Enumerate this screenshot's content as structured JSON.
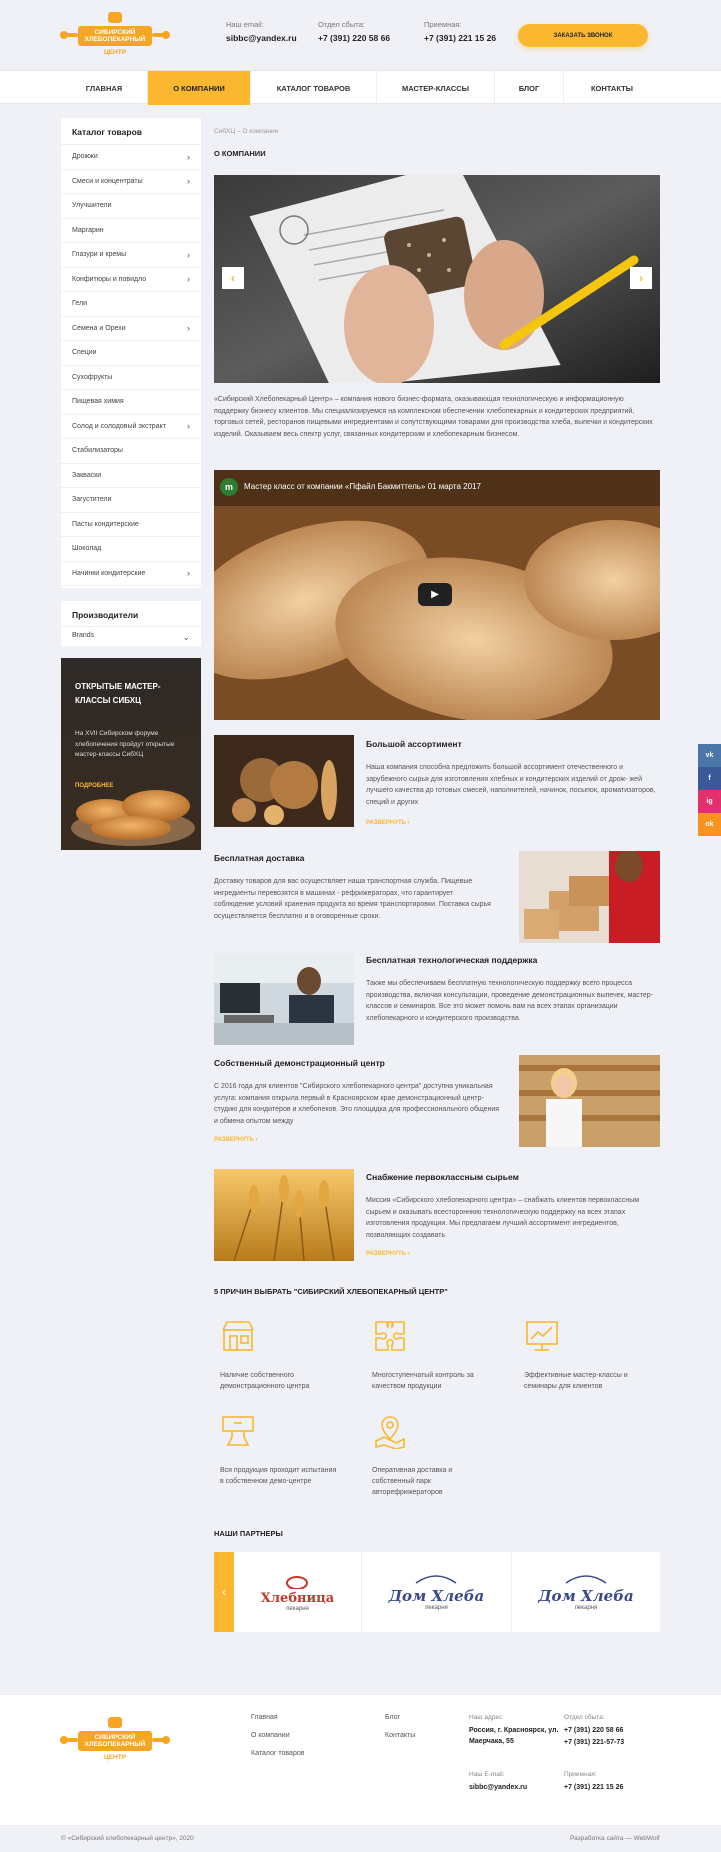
{
  "header": {
    "logo_text": "СИБИРСКИЙ ХЛЕБОПЕКАРНЫЙ ЦЕНТР",
    "email_label": "Наш email:",
    "email": "sibbc@yandex.ru",
    "sales_label": "Отдел сбыта:",
    "sales_phone": "+7 (391) 220 58 66",
    "reception_label": "Приемная:",
    "reception_phone": "+7 (391) 221 15 26",
    "call_button": "ЗАКАЗАТЬ ЗВОНОК"
  },
  "nav": [
    "ГЛАВНАЯ",
    "О КОМПАНИИ",
    "КАТАЛОГ ТОВАРОВ",
    "МАСТЕР-КЛАССЫ",
    "БЛОГ",
    "КОНТАКТЫ"
  ],
  "sidebar": {
    "catalog_title": "Каталог товаров",
    "items": [
      {
        "label": "Дрожжи",
        "arrow": true
      },
      {
        "label": "Смеси и концентраты",
        "arrow": true
      },
      {
        "label": "Улучшители",
        "arrow": false
      },
      {
        "label": "Маргарин",
        "arrow": false
      },
      {
        "label": "Глазури и кремы",
        "arrow": true
      },
      {
        "label": "Конфитюры и повидло",
        "arrow": true
      },
      {
        "label": "Гели",
        "arrow": false
      },
      {
        "label": "Семена и Орехи",
        "arrow": true
      },
      {
        "label": "Специи",
        "arrow": false
      },
      {
        "label": "Сухофрукты",
        "arrow": false
      },
      {
        "label": "Пищевая химия",
        "arrow": false
      },
      {
        "label": "Солод и солодовый экстракт",
        "arrow": true
      },
      {
        "label": "Стабилизаторы",
        "arrow": false
      },
      {
        "label": "Закваски",
        "arrow": false
      },
      {
        "label": "Загустители",
        "arrow": false
      },
      {
        "label": "Пасты кондитерские",
        "arrow": false
      },
      {
        "label": "Шоколад",
        "arrow": false
      },
      {
        "label": "Начинки кондитерские",
        "arrow": true
      }
    ],
    "producers_title": "Производители",
    "producers_value": "Brands",
    "banner_title": "ОТКРЫТЫЕ МАСТЕР-КЛАССЫ СИБХЦ",
    "banner_text": "На XVII Сибирском форуме хлебопечения пройдут открытые мастер-классы СибХЦ",
    "banner_more": "ПОДРОБНЕЕ"
  },
  "main": {
    "breadcrumb": "СибХЦ – О компании",
    "title": "О КОМПАНИИ",
    "intro": "«Сибирский Хлебопекарный Центр» – компания нового бизнес-формата, оказывающая технологическую и информационную поддержку бизнесу клиентов. Мы специализируемся на комплексном обеспечении хлебопекарных и кондитерских предприятий, торговых сетей, ресторанов пищевыми ингредиентами и сопутствующими товарами для производства хлеба, выпечки и кондитерских изделий. Оказываем весь спектр услуг, связанных кондитерским и хлебопекарным бизнесом.",
    "video_title": "Мастер класс от компании «Пфайл Бакмиттель» 01 марта 2017",
    "video_channel": "m",
    "features": [
      {
        "title": "Большой ассортимент",
        "text": "Наша компания способна предложить большой ассортимент отечественного и зарубежного сырья для изготовления хлебных и кондитерских изделий от дрож- жей лучшего качества до готовых смесей, наполнителей, начинок, посыпок, ароматизаторов, специй и других",
        "more": "РАЗВЕРНУТЬ ›"
      },
      {
        "title": "Бесплатная доставка",
        "text": "Доставку товаров для вас осуществляет наша транспортная служба. Пищевые ингредиенты перевозятся в машинах - рефрижераторах, что гарантирует соблюдение условий хранения продукта во время транспортировки. Поставка сырья осуществляется бесплатно и в оговоренные сроки.",
        "more": ""
      },
      {
        "title": "Бесплатная технологическая поддержка",
        "text": "Также мы обеспечиваем бесплатную технологическую поддержку всего процесса производства, включая консультации, проведение демонстрационных выпечек, мастер-классов и семинаров. Все это может помочь вам на всех этапах организации хлебопекарного и кондитерского производства.",
        "more": ""
      },
      {
        "title": "Собственный демонстрационный центр",
        "text": "С 2016 года для клиентов \"Сибирского хлебопекарного центра\" доступна уникальная услуга: компания открыла первый в Красноярском крае демонстрационный центр-студию для кондитеров и хлебопеков. Это площадка для профессионального общения и обмена опытом между",
        "more": "РАЗВЕРНУТЬ ›"
      },
      {
        "title": "Снабжение первоклассным сырьем",
        "text": "Миссия «Сибирского хлебопекарного центра» – снабжать клиентов первоклассным сырьем и оказывать всестороннюю технологическую поддержку на всех этапах изготовления продукции. Мы предлагаем лучший ассортимент ингредиентов, позволяющих создавать",
        "more": "РАЗВЕРНУТЬ ›"
      }
    ],
    "reasons_title": "5 ПРИЧИН ВЫБРАТЬ \"СИБИРСКИЙ ХЛЕБОПЕКАРНЫЙ ЦЕНТР\"",
    "reasons": [
      "Наличие собственного демонстрационного центра",
      "Многоступенчатый контроль за качеством продукции",
      "Эффективные мастер-классы и семинары для клиентов",
      "Вся продукция проходит испытания в собственном демо-центре",
      "Оперативная доставка и собственный парк авторефрижераторов"
    ],
    "partners_title": "НАШИ ПАРТНЕРЫ",
    "partners": [
      {
        "name": "Хлебница",
        "sub": "пекарня"
      },
      {
        "name": "Дом Хлеба",
        "sub": "пекарня"
      },
      {
        "name": "Дом Хлеба",
        "sub": "пекарня"
      }
    ]
  },
  "social": [
    {
      "label": "vk",
      "color": "#4a76a8"
    },
    {
      "label": "f",
      "color": "#3b5998"
    },
    {
      "label": "ig",
      "color": "#e1306c"
    },
    {
      "label": "ok",
      "color": "#f7931e"
    }
  ],
  "footer": {
    "links_col1": [
      "Главная",
      "О компании",
      "Каталог товаров"
    ],
    "links_col2": [
      "Блог",
      "Контакты"
    ],
    "address_label": "Наш адрес:",
    "address": "Россия, г. Красноярск, ул. Маерчака, 55",
    "sales_label": "Отдел сбыта:",
    "sales_phone1": "+7 (391) 220 58 66",
    "sales_phone2": "+7 (391) 221-57-73",
    "email_label": "Наш E-mail:",
    "email": "sibbc@yandex.ru",
    "reception_label": "Приемная:",
    "reception_phone": "+7 (391) 221 15 26",
    "copyright": "© «Сибирский хлебопекарный центр», 2020",
    "developer": "Разработка сайта — WebWolf"
  },
  "colors": {
    "accent": "#fbb72f",
    "background": "#f0f1f6"
  }
}
